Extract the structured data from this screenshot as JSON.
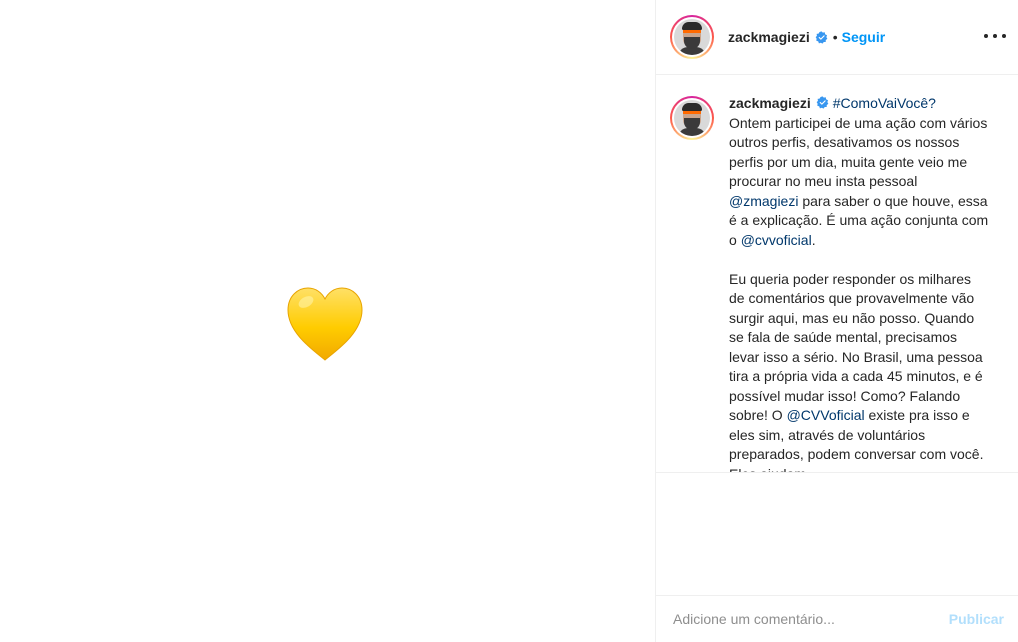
{
  "post": {
    "media": {
      "emoji": "yellow-heart-icon"
    },
    "author": {
      "username": "zackmagiezi",
      "verified": true,
      "follow_label": "Seguir",
      "separator": "•"
    },
    "caption": {
      "username": "zackmagiezi",
      "hashtag": "#ComoVaiVocê?",
      "p1_a": "Ontem participei de uma ação com vários outros perfis, desativamos os nossos perfis por um dia, muita gente veio me procurar no meu insta pessoal ",
      "mention1": "@zmagiezi",
      "p1_b": " para saber o que houve, essa é a explicação. É uma ação conjunta com o ",
      "mention2": "@cvvoficial",
      "p1_c": ".",
      "p2_a": "Eu queria poder responder os milhares de comentários que provavelmente vão surgir aqui, mas eu não posso. Quando se fala de saúde mental, precisamos levar isso a sério. No Brasil, uma pessoa tira a própria vida a cada 45 minutos, e é possível mudar isso! Como? Falando sobre! O ",
      "mention3": "@CVVoficial",
      "p2_b": " existe pra isso e eles sim, através de voluntários preparados, podem conversar com você. Eles ajudam"
    },
    "comment_box": {
      "placeholder": "Adicione um comentário...",
      "publish_label": "Publicar"
    }
  },
  "colors": {
    "follow": "#0095f6",
    "link": "#00376b",
    "publish_disabled": "#b2dffc",
    "heart": "#ffcc00"
  }
}
